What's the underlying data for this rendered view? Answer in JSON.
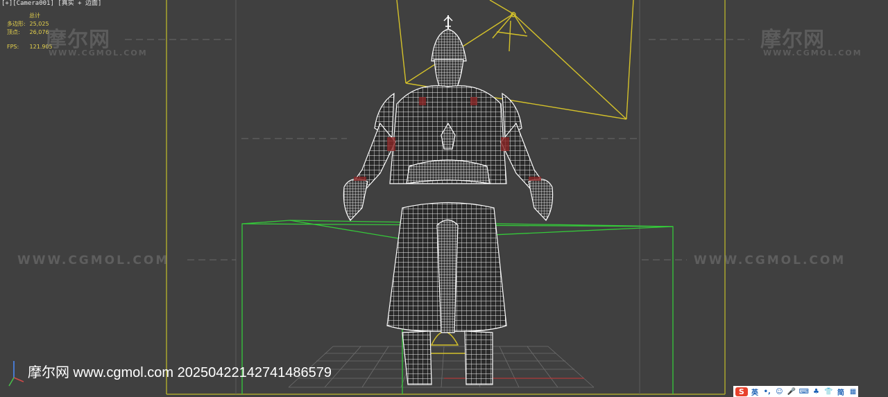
{
  "viewport": {
    "label_parts": [
      "[+]",
      "[Camera001]",
      "[真实 + 边面]"
    ]
  },
  "stats": {
    "total_label": "总计",
    "polys_label": "多边形:",
    "polys_value": "25,025",
    "verts_label": "顶点:",
    "verts_value": "26,076",
    "fps_label": "FPS:",
    "fps_value": "121.905"
  },
  "watermarks": {
    "brand_cn": "摩尔网",
    "url_small": "WWW.CGMOL.COM",
    "url": "WWW.CGMOL.COM",
    "bottom_text": "摩尔网 www.cgmol.com 20250422142741486579"
  },
  "ime_toolbar": {
    "logo": "S",
    "items": [
      {
        "name": "lang-toggle",
        "glyph": "英"
      },
      {
        "name": "punctuation",
        "glyph": "•,"
      },
      {
        "name": "emoji",
        "glyph": "☺"
      },
      {
        "name": "voice",
        "glyph": "🎤"
      },
      {
        "name": "keyboard",
        "glyph": "⌨"
      },
      {
        "name": "tools",
        "glyph": "♣"
      },
      {
        "name": "skin",
        "glyph": "👕"
      },
      {
        "name": "simplified",
        "glyph": "简"
      },
      {
        "name": "menu",
        "glyph": "▦"
      }
    ]
  },
  "colors": {
    "background": "#404040",
    "camera_gizmo": "#d4c12a",
    "bounding_box": "#35c93a",
    "wireframe": "#ffffff",
    "stats_text": "#e6d24c"
  }
}
